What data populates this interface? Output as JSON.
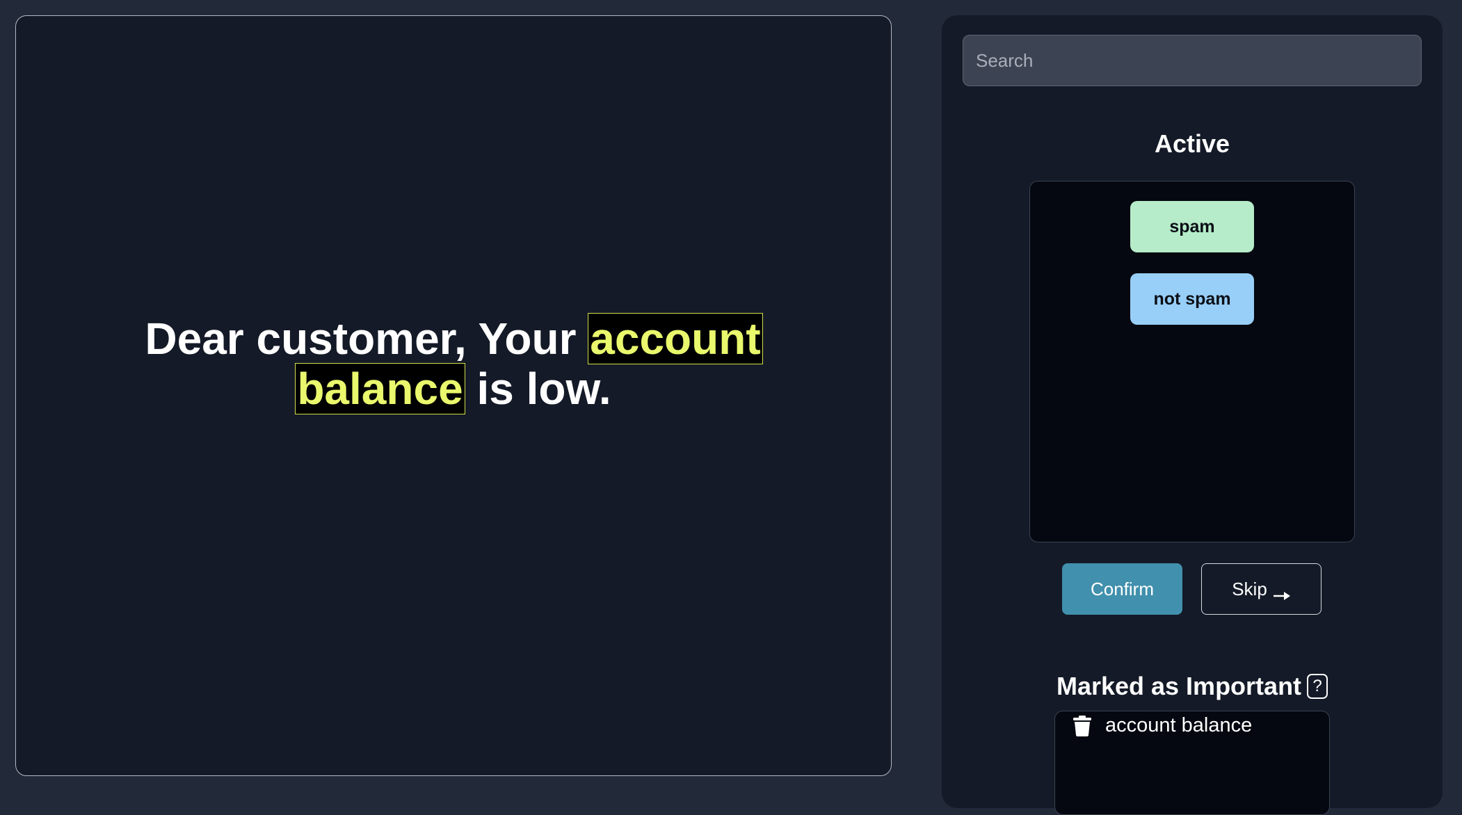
{
  "text_panel": {
    "segments": [
      {
        "text": "Dear customer, Your ",
        "highlighted": false
      },
      {
        "text": "account",
        "highlighted": true
      },
      {
        "text": " ",
        "highlighted": false
      },
      {
        "text": "balance",
        "highlighted": true
      },
      {
        "text": " is low.",
        "highlighted": false
      }
    ],
    "highlight_color": "#e9f86c"
  },
  "sidebar": {
    "search_placeholder": "Search",
    "search_value": "",
    "active_heading": "Active",
    "labels": [
      {
        "text": "spam",
        "color": "#b6ecc9"
      },
      {
        "text": "not spam",
        "color": "#98cff9"
      }
    ],
    "confirm_label": "Confirm",
    "skip_label": "Skip",
    "skip_icon": "arrow-right-icon",
    "important_heading": "Marked as Important",
    "help_label": "?",
    "important_items": [
      {
        "text": "account balance",
        "icon": "trash-icon"
      }
    ],
    "accent_color": "#4190ad"
  }
}
